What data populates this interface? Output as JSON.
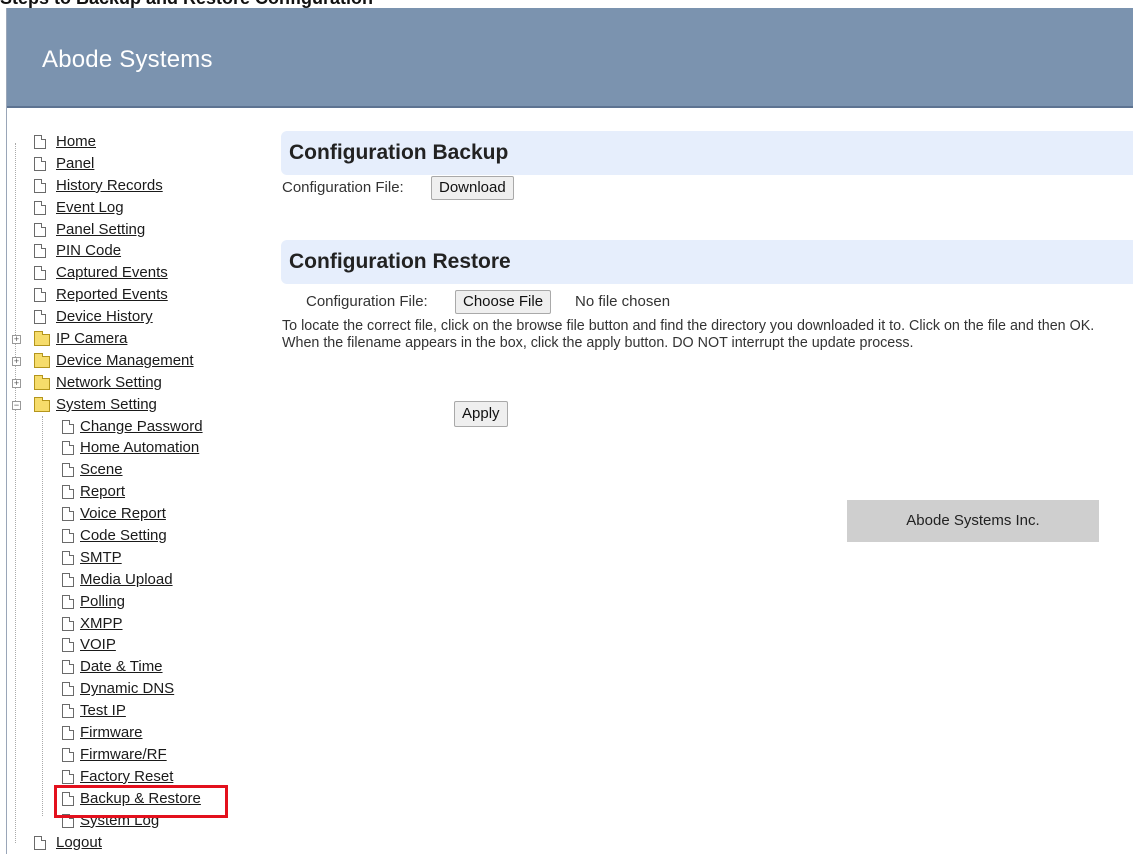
{
  "top_caption": "Steps to Backup and Restore Configuration",
  "header": {
    "brand": "Abode Systems"
  },
  "sidebar": {
    "items": [
      {
        "label": "Home",
        "type": "page",
        "level": 0
      },
      {
        "label": "Panel",
        "type": "page",
        "level": 0
      },
      {
        "label": "History Records",
        "type": "page",
        "level": 0
      },
      {
        "label": "Event Log",
        "type": "page",
        "level": 0
      },
      {
        "label": "Panel Setting",
        "type": "page",
        "level": 0
      },
      {
        "label": "PIN Code",
        "type": "page",
        "level": 0
      },
      {
        "label": "Captured Events",
        "type": "page",
        "level": 0
      },
      {
        "label": "Reported Events",
        "type": "page",
        "level": 0
      },
      {
        "label": "Device History",
        "type": "page",
        "level": 0
      },
      {
        "label": "IP Camera",
        "type": "folder",
        "level": 0
      },
      {
        "label": "Device Management",
        "type": "folder",
        "level": 0
      },
      {
        "label": "Network Setting",
        "type": "folder",
        "level": 0
      },
      {
        "label": "System Setting",
        "type": "folder-open",
        "level": 0
      },
      {
        "label": "Change Password",
        "type": "page",
        "level": 1
      },
      {
        "label": "Home Automation",
        "type": "page",
        "level": 1
      },
      {
        "label": "Scene",
        "type": "page",
        "level": 1
      },
      {
        "label": "Report",
        "type": "page",
        "level": 1
      },
      {
        "label": "Voice Report",
        "type": "page",
        "level": 1
      },
      {
        "label": "Code Setting",
        "type": "page",
        "level": 1
      },
      {
        "label": "SMTP",
        "type": "page",
        "level": 1
      },
      {
        "label": "Media Upload",
        "type": "page",
        "level": 1
      },
      {
        "label": "Polling",
        "type": "page",
        "level": 1
      },
      {
        "label": "XMPP",
        "type": "page",
        "level": 1
      },
      {
        "label": "VOIP",
        "type": "page",
        "level": 1
      },
      {
        "label": "Date & Time",
        "type": "page",
        "level": 1
      },
      {
        "label": "Dynamic DNS",
        "type": "page",
        "level": 1
      },
      {
        "label": "Test IP",
        "type": "page",
        "level": 1
      },
      {
        "label": "Firmware",
        "type": "page",
        "level": 1
      },
      {
        "label": "Firmware/RF",
        "type": "page",
        "level": 1
      },
      {
        "label": "Factory Reset",
        "type": "page",
        "level": 1
      },
      {
        "label": "Backup & Restore",
        "type": "page",
        "level": 1
      },
      {
        "label": "System Log",
        "type": "page",
        "level": 1
      },
      {
        "label": "Logout",
        "type": "page",
        "level": 0
      }
    ],
    "highlight_color": "#e3101d"
  },
  "backup": {
    "title": "Configuration Backup",
    "file_label": "Configuration File:",
    "download_label": "Download"
  },
  "restore": {
    "title": "Configuration Restore",
    "file_label": "Configuration File:",
    "choose_label": "Choose File",
    "no_file": "No file chosen",
    "help": "To locate the correct file, click on the browse file button and find the directory you downloaded it to. Click on the file and then OK. When the filename appears in the box, click the apply button. DO NOT interrupt the update process.",
    "apply_label": "Apply"
  },
  "footer": {
    "company": "Abode Systems Inc."
  },
  "colors": {
    "header_bg": "#7b93af",
    "section_bg": "#e6eefc",
    "footer_bg": "#cfcfcf"
  }
}
